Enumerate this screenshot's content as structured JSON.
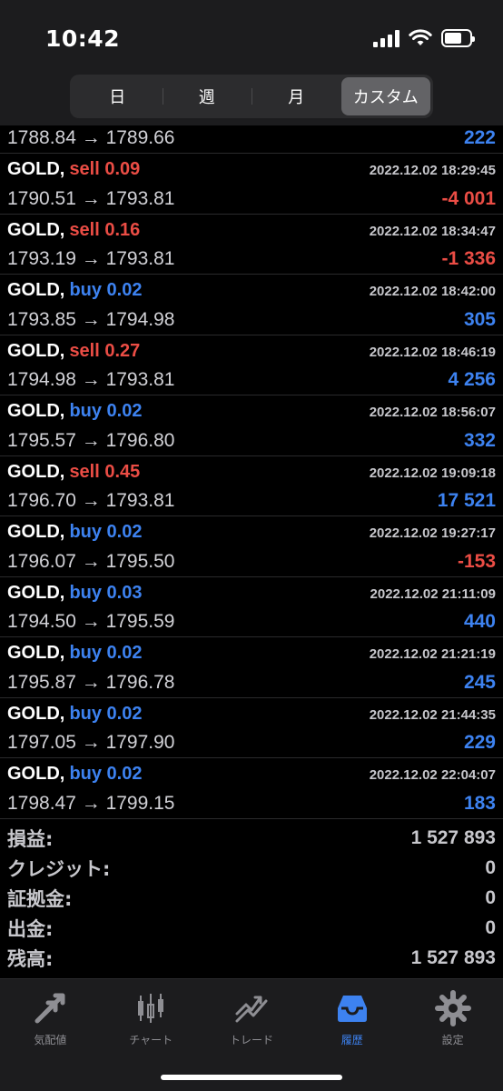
{
  "status": {
    "time": "10:42"
  },
  "segments": [
    {
      "label": "日",
      "active": false
    },
    {
      "label": "週",
      "active": false
    },
    {
      "label": "月",
      "active": false
    },
    {
      "label": "カスタム",
      "active": true
    }
  ],
  "first_row": {
    "prices": "1788.84 → 1789.66",
    "profit": "222"
  },
  "trades": [
    {
      "symbol": "GOLD,",
      "side": "sell",
      "volume": "0.09",
      "side_text": "sell 0.09",
      "time": "2022.12.02 18:29:45",
      "prices": "1790.51 → 1793.81",
      "profit": "-4 001",
      "profit_sign": "neg"
    },
    {
      "symbol": "GOLD,",
      "side": "sell",
      "volume": "0.16",
      "side_text": "sell 0.16",
      "time": "2022.12.02 18:34:47",
      "prices": "1793.19 → 1793.81",
      "profit": "-1 336",
      "profit_sign": "neg"
    },
    {
      "symbol": "GOLD,",
      "side": "buy",
      "volume": "0.02",
      "side_text": "buy 0.02",
      "time": "2022.12.02 18:42:00",
      "prices": "1793.85 → 1794.98",
      "profit": "305",
      "profit_sign": "pos"
    },
    {
      "symbol": "GOLD,",
      "side": "sell",
      "volume": "0.27",
      "side_text": "sell 0.27",
      "time": "2022.12.02 18:46:19",
      "prices": "1794.98 → 1793.81",
      "profit": "4 256",
      "profit_sign": "pos"
    },
    {
      "symbol": "GOLD,",
      "side": "buy",
      "volume": "0.02",
      "side_text": "buy 0.02",
      "time": "2022.12.02 18:56:07",
      "prices": "1795.57 → 1796.80",
      "profit": "332",
      "profit_sign": "pos"
    },
    {
      "symbol": "GOLD,",
      "side": "sell",
      "volume": "0.45",
      "side_text": "sell 0.45",
      "time": "2022.12.02 19:09:18",
      "prices": "1796.70 → 1793.81",
      "profit": "17 521",
      "profit_sign": "pos"
    },
    {
      "symbol": "GOLD,",
      "side": "buy",
      "volume": "0.02",
      "side_text": "buy 0.02",
      "time": "2022.12.02 19:27:17",
      "prices": "1796.07 → 1795.50",
      "profit": "-153",
      "profit_sign": "neg"
    },
    {
      "symbol": "GOLD,",
      "side": "buy",
      "volume": "0.03",
      "side_text": "buy 0.03",
      "time": "2022.12.02 21:11:09",
      "prices": "1794.50 → 1795.59",
      "profit": "440",
      "profit_sign": "pos"
    },
    {
      "symbol": "GOLD,",
      "side": "buy",
      "volume": "0.02",
      "side_text": "buy 0.02",
      "time": "2022.12.02 21:21:19",
      "prices": "1795.87 → 1796.78",
      "profit": "245",
      "profit_sign": "pos"
    },
    {
      "symbol": "GOLD,",
      "side": "buy",
      "volume": "0.02",
      "side_text": "buy 0.02",
      "time": "2022.12.02 21:44:35",
      "prices": "1797.05 → 1797.90",
      "profit": "229",
      "profit_sign": "pos"
    },
    {
      "symbol": "GOLD,",
      "side": "buy",
      "volume": "0.02",
      "side_text": "buy 0.02",
      "time": "2022.12.02 22:04:07",
      "prices": "1798.47 → 1799.15",
      "profit": "183",
      "profit_sign": "pos"
    }
  ],
  "summary": [
    {
      "label": "損益:",
      "value": "1 527 893"
    },
    {
      "label": "クレジット:",
      "value": "0"
    },
    {
      "label": "証拠金:",
      "value": "0"
    },
    {
      "label": "出金:",
      "value": "0"
    },
    {
      "label": "残高:",
      "value": "1 527 893"
    }
  ],
  "tabs": [
    {
      "label": "気配値",
      "icon": "quotes-arrows-icon",
      "active": false
    },
    {
      "label": "チャート",
      "icon": "candlestick-icon",
      "active": false
    },
    {
      "label": "トレード",
      "icon": "trade-trend-icon",
      "active": false
    },
    {
      "label": "履歴",
      "icon": "history-tray-icon",
      "active": true
    },
    {
      "label": "設定",
      "icon": "gear-icon",
      "active": false
    }
  ],
  "colors": {
    "buy": "#3d82f0",
    "sell": "#eb4d45",
    "active_tab": "#3d82f0"
  }
}
